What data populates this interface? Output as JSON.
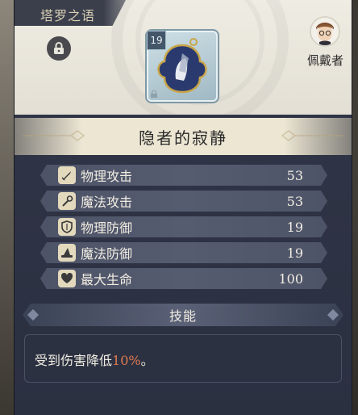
{
  "header": {
    "title": "塔罗之语",
    "lock_icon": "lock-icon",
    "item_level": "19",
    "character_name": "佩戴者"
  },
  "item": {
    "name": "隐者的寂静"
  },
  "stats": [
    {
      "icon": "sword-icon",
      "label": "物理攻击",
      "value": "53"
    },
    {
      "icon": "staff-icon",
      "label": "魔法攻击",
      "value": "53"
    },
    {
      "icon": "shield-icon",
      "label": "物理防御",
      "value": "19"
    },
    {
      "icon": "witch-hat-icon",
      "label": "魔法防御",
      "value": "19"
    },
    {
      "icon": "heart-icon",
      "label": "最大生命",
      "value": "100"
    }
  ],
  "skill": {
    "title": "技能",
    "text_before": "受到伤害降低",
    "highlight": "10%",
    "text_after": "。",
    "highlight_color": "#e07a4f"
  }
}
